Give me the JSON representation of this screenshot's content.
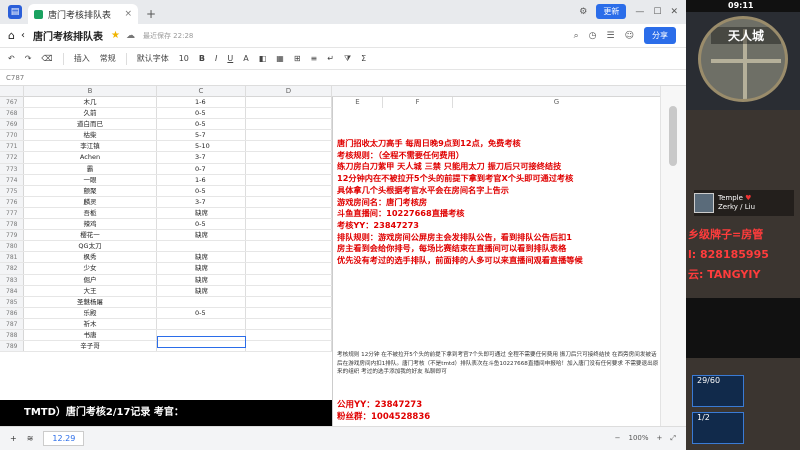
{
  "browser": {
    "tab_title": "唐门考核排队表",
    "tab_close": "×",
    "new_tab": "+",
    "update_button": "更新"
  },
  "titlebar": {
    "doc_title": "唐门考核排队表",
    "saved_status": "最近保存 22:28",
    "share_button": "分享"
  },
  "toolbar": {
    "insert": "插入",
    "style": "常规",
    "font": "默认字体",
    "font_size": "10"
  },
  "formula": {
    "cell_ref": "C787"
  },
  "columns": {
    "row": "",
    "b": "B",
    "c": "C",
    "d": "D",
    "e": "E",
    "f": "F",
    "g": "G"
  },
  "rows": [
    {
      "n": "767",
      "b": "木几",
      "c": "1-6"
    },
    {
      "n": "768",
      "b": "久前",
      "c": "0-5"
    },
    {
      "n": "769",
      "b": "道白而已",
      "c": "0-5"
    },
    {
      "n": "770",
      "b": "枯柴",
      "c": "5-7"
    },
    {
      "n": "771",
      "b": "李江镇",
      "c": "5-10"
    },
    {
      "n": "772",
      "b": "Achen",
      "c": "3-7"
    },
    {
      "n": "773",
      "b": "霸",
      "c": "0-7"
    },
    {
      "n": "774",
      "b": "一眼",
      "c": "1-6"
    },
    {
      "n": "775",
      "b": "颤聚",
      "c": "0-5"
    },
    {
      "n": "776",
      "b": "麟灵",
      "c": "3-7"
    },
    {
      "n": "777",
      "b": "吾栀",
      "c": "缺席"
    },
    {
      "n": "778",
      "b": "辣鸡",
      "c": "0-5"
    },
    {
      "n": "779",
      "b": "樱花一",
      "c": "缺席"
    },
    {
      "n": "780",
      "b": "QG太刀",
      "c": ""
    },
    {
      "n": "781",
      "b": "枫秀",
      "c": "缺席"
    },
    {
      "n": "782",
      "b": "少女",
      "c": "缺席"
    },
    {
      "n": "783",
      "b": "倔户",
      "c": "缺席"
    },
    {
      "n": "784",
      "b": "大王",
      "c": "缺席"
    },
    {
      "n": "785",
      "b": "圣魅杨屠",
      "c": ""
    },
    {
      "n": "786",
      "b": "乐殿",
      "c": "0-5"
    },
    {
      "n": "787",
      "b": "祈木",
      "c": ""
    },
    {
      "n": "788",
      "b": "书唐",
      "c": ""
    },
    {
      "n": "789",
      "b": "辛子哥",
      "c": ""
    }
  ],
  "notice": {
    "red_lines": [
      "唐门招收太刀高手 每周日晚9点到12点，免费考核",
      "考核规则：（全程不需要任何费用）",
      "练刀房白刀紫甲 天人城 三禁 只能用太刀 振刀后只可接终结技",
      "12分钟内在不被拉开5个头的前提下拿到考官X个头即可通过考核",
      "具体拿几个头根据考官水平会在房间名字上告示",
      "游戏房间名：唐门考核房",
      "斗鱼直播间：10227668直播考核",
      "考核YY：23847273",
      "排队规则：游戏房间公屏房主会发排队公告，看到排队公告后扣1",
      "房主看到会给你排号，每场比赛结束在直播间可以看到排队表格",
      "优先没有考过的选手排队，前面排的人多可以来直播间观看直播等候"
    ],
    "small_text": "考核规则 12分钟 在不被拉开5个头的前提下拿到考官7个头即可通过 全程不需要任何费用 振刀后只可接终结技 在西旁房间发被话后在游戏房间内扣1排队。唐门考核（不是tmtd）排队表次在斗鱼10227668直播间申报哈！加入唐门没有任何要求 不需要退出原来的组织 考过的选手添加我的好友 私聊即可",
    "yy_line": "公用YY：23847273",
    "fans_line": "粉丝群：1004528836"
  },
  "overlay": {
    "text": "TMTD）唐门考核2/17记录   考官："
  },
  "sheetbar": {
    "add": "+",
    "sheet_tab": "12.29",
    "zoom": "100%"
  },
  "stream": {
    "clock": "09:11",
    "map_title": "天人城",
    "member_name": "Temple",
    "member_sub": "Zerky / Liu",
    "banner_lines": [
      "乡级牌子=房管",
      "l: 828185995",
      "云: TANGYIY"
    ],
    "stat1": "29/60",
    "stat2": "1/2"
  },
  "colors": {
    "accent": "#2b6de9",
    "notice_red": "#e00000"
  }
}
